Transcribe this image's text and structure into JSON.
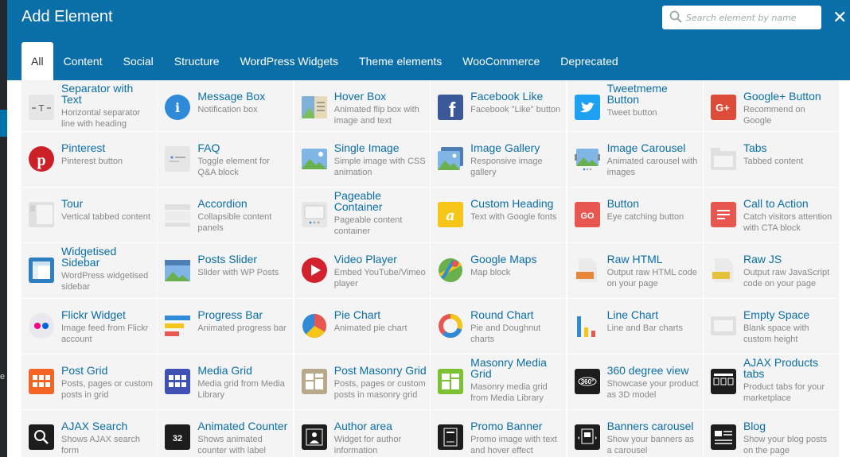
{
  "dialog": {
    "title": "Add Element",
    "search_placeholder": "Search element by name",
    "close_glyph": "✕"
  },
  "tabs": [
    "All",
    "Content",
    "Social",
    "Structure",
    "WordPress Widgets",
    "Theme elements",
    "WooCommerce",
    "Deprecated"
  ],
  "active_tab": "All",
  "colors": {
    "header": "#0a6ea8",
    "tile_bg": "#f4f4f4",
    "name": "#0a6ea8",
    "desc": "#888888"
  },
  "elements": [
    [
      {
        "name": "Separator with Text",
        "desc": "Horizontal separator line with heading",
        "icon": "separator-icon"
      },
      {
        "name": "Message Box",
        "desc": "Notification box",
        "icon": "info-icon"
      },
      {
        "name": "Hover Box",
        "desc": "Animated flip box with image and text",
        "icon": "hover-box-icon"
      },
      {
        "name": "Facebook Like",
        "desc": "Facebook \"Like\" button",
        "icon": "facebook-icon"
      },
      {
        "name": "Tweetmeme Button",
        "desc": "Tweet button",
        "icon": "twitter-icon"
      },
      {
        "name": "Google+ Button",
        "desc": "Recommend on Google",
        "icon": "google-plus-icon"
      }
    ],
    [
      {
        "name": "Pinterest",
        "desc": "Pinterest button",
        "icon": "pinterest-icon"
      },
      {
        "name": "FAQ",
        "desc": "Toggle element for Q&A block",
        "icon": "faq-icon"
      },
      {
        "name": "Single Image",
        "desc": "Simple image with CSS animation",
        "icon": "image-icon"
      },
      {
        "name": "Image Gallery",
        "desc": "Responsive image gallery",
        "icon": "gallery-icon"
      },
      {
        "name": "Image Carousel",
        "desc": "Animated carousel with images",
        "icon": "carousel-icon"
      },
      {
        "name": "Tabs",
        "desc": "Tabbed content",
        "icon": "tabs-icon"
      }
    ],
    [
      {
        "name": "Tour",
        "desc": "Vertical tabbed content",
        "icon": "tour-icon"
      },
      {
        "name": "Accordion",
        "desc": "Collapsible content panels",
        "icon": "accordion-icon"
      },
      {
        "name": "Pageable Container",
        "desc": "Pageable content container",
        "icon": "pageable-icon"
      },
      {
        "name": "Custom Heading",
        "desc": "Text with Google fonts",
        "icon": "heading-icon"
      },
      {
        "name": "Button",
        "desc": "Eye catching button",
        "icon": "button-icon"
      },
      {
        "name": "Call to Action",
        "desc": "Catch visitors attention with CTA block",
        "icon": "cta-icon"
      }
    ],
    [
      {
        "name": "Widgetised Sidebar",
        "desc": "WordPress widgetised sidebar",
        "icon": "sidebar-icon"
      },
      {
        "name": "Posts Slider",
        "desc": "Slider with WP Posts",
        "icon": "slider-icon"
      },
      {
        "name": "Video Player",
        "desc": "Embed YouTube/Vimeo player",
        "icon": "play-icon"
      },
      {
        "name": "Google Maps",
        "desc": "Map block",
        "icon": "map-icon"
      },
      {
        "name": "Raw HTML",
        "desc": "Output raw HTML code on your page",
        "icon": "html-file-icon"
      },
      {
        "name": "Raw JS",
        "desc": "Output raw JavaScript code on your page",
        "icon": "js-file-icon"
      }
    ],
    [
      {
        "name": "Flickr Widget",
        "desc": "Image feed from Flickr account",
        "icon": "flickr-icon"
      },
      {
        "name": "Progress Bar",
        "desc": "Animated progress bar",
        "icon": "progress-bar-icon"
      },
      {
        "name": "Pie Chart",
        "desc": "Animated pie chart",
        "icon": "pie-chart-icon"
      },
      {
        "name": "Round Chart",
        "desc": "Pie and Doughnut charts",
        "icon": "round-chart-icon"
      },
      {
        "name": "Line Chart",
        "desc": "Line and Bar charts",
        "icon": "line-chart-icon"
      },
      {
        "name": "Empty Space",
        "desc": "Blank space with custom height",
        "icon": "empty-space-icon"
      }
    ],
    [
      {
        "name": "Post Grid",
        "desc": "Posts, pages or custom posts in grid",
        "icon": "post-grid-icon"
      },
      {
        "name": "Media Grid",
        "desc": "Media grid from Media Library",
        "icon": "media-grid-icon"
      },
      {
        "name": "Post Masonry Grid",
        "desc": "Posts, pages or custom posts in masonry grid",
        "icon": "post-masonry-icon"
      },
      {
        "name": "Masonry Media Grid",
        "desc": "Masonry media grid from Media Library",
        "icon": "masonry-media-icon"
      },
      {
        "name": "360 degree view",
        "desc": "Showcase your product as 3D model",
        "icon": "360-icon"
      },
      {
        "name": "AJAX Products tabs",
        "desc": "Product tabs for your marketplace",
        "icon": "product-tabs-icon"
      }
    ],
    [
      {
        "name": "AJAX Search",
        "desc": "Shows AJAX search form",
        "icon": "search-icon"
      },
      {
        "name": "Animated Counter",
        "desc": "Shows animated counter with label",
        "icon": "counter-icon",
        "icon_text": "32"
      },
      {
        "name": "Author area",
        "desc": "Widget for author information",
        "icon": "author-icon"
      },
      {
        "name": "Promo Banner",
        "desc": "Promo image with text and hover effect",
        "icon": "promo-banner-icon"
      },
      {
        "name": "Banners carousel",
        "desc": "Show your banners as a carousel",
        "icon": "banners-carousel-icon"
      },
      {
        "name": "Blog",
        "desc": "Show your blog posts on the page",
        "icon": "blog-icon"
      }
    ]
  ]
}
